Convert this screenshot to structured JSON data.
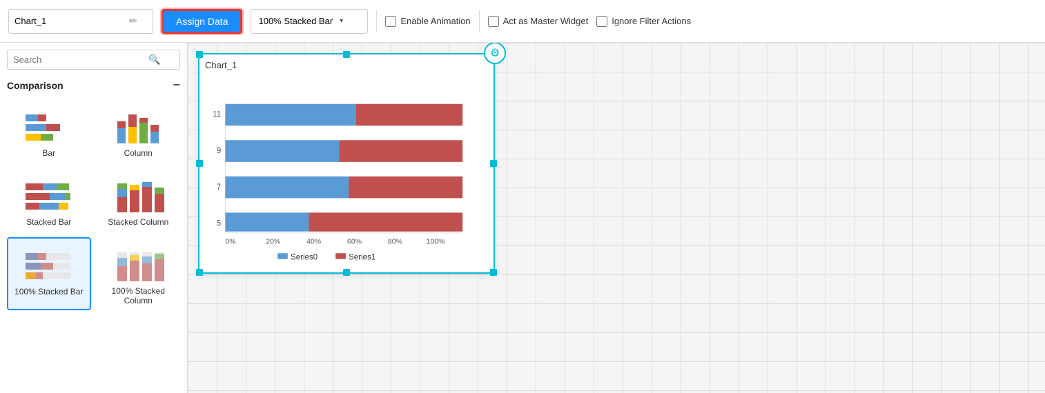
{
  "topbar": {
    "chart_name": "Chart_1",
    "assign_data_label": "Assign Data",
    "chart_type_label": "100% Stacked Bar",
    "enable_animation_label": "Enable Animation",
    "act_as_master_label": "Act as Master Widget",
    "ignore_filter_label": "Ignore Filter Actions",
    "enable_animation_checked": false,
    "act_as_master_checked": false,
    "ignore_filter_checked": false
  },
  "sidebar": {
    "search_placeholder": "Search",
    "section_label": "Comparison",
    "chart_types": [
      {
        "id": "bar",
        "label": "Bar"
      },
      {
        "id": "column",
        "label": "Column"
      },
      {
        "id": "stacked-bar",
        "label": "Stacked Bar"
      },
      {
        "id": "stacked-column",
        "label": "Stacked Column"
      },
      {
        "id": "100pct-stacked-bar",
        "label": "100% Stacked Bar",
        "selected": true
      },
      {
        "id": "100pct-stacked-column",
        "label": "100% Stacked Column"
      }
    ]
  },
  "widget": {
    "title": "Chart_1",
    "series": [
      "Series0",
      "Series1"
    ],
    "x_labels": [
      "0%",
      "20%",
      "40%",
      "60%",
      "80%",
      "100%"
    ],
    "y_labels": [
      "5",
      "7",
      "9",
      "11"
    ],
    "bars": [
      {
        "y": "11",
        "blue_pct": 55,
        "red_pct": 45
      },
      {
        "y": "9",
        "blue_pct": 48,
        "red_pct": 52
      },
      {
        "y": "7",
        "blue_pct": 52,
        "red_pct": 48
      },
      {
        "y": "5",
        "blue_pct": 35,
        "red_pct": 65
      }
    ],
    "color_blue": "#5b9bd5",
    "color_red": "#c0504d"
  },
  "icons": {
    "pencil": "✏",
    "search": "🔍",
    "chevron_down": "▾",
    "minus": "−",
    "gear": "⚙"
  }
}
